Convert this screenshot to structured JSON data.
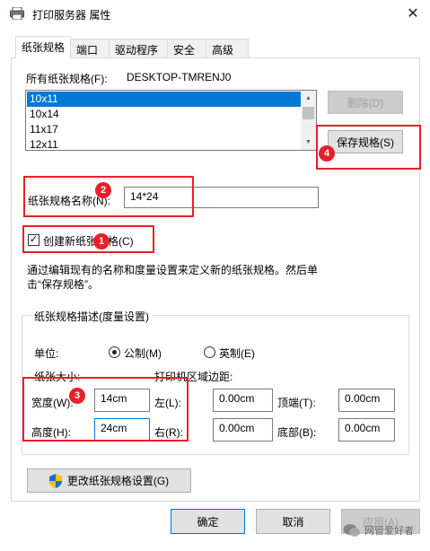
{
  "window": {
    "title": "打印服务器 属性",
    "close_symbol": "✕"
  },
  "tabs": [
    {
      "label": "纸张规格",
      "active": true
    },
    {
      "label": "端口",
      "active": false
    },
    {
      "label": "驱动程序",
      "active": false
    },
    {
      "label": "安全",
      "active": false
    },
    {
      "label": "高级",
      "active": false
    }
  ],
  "forms": {
    "all_forms_label": "所有纸张规格(F):",
    "server_name": "DESKTOP-TMRENJ0",
    "items": [
      "10x11",
      "10x14",
      "11x17",
      "12x11"
    ],
    "selected_index": 0,
    "delete_button": "删除(D)",
    "save_button": "保存规格(S)",
    "form_name_label": "纸张规格名称(N):",
    "form_name_value": "14*24",
    "create_checkbox_label": "创建新纸张规格(C)",
    "create_checked": true,
    "description_line1": "通过编辑现有的名称和度量设置来定义新的纸张规格。然后单",
    "description_line2": "击“保存规格”。"
  },
  "measurements": {
    "group_title": "纸张规格描述(度量设置)",
    "units_label": "单位:",
    "metric_label": "公制(M)",
    "english_label": "英制(E)",
    "metric_selected": true,
    "paper_size_label": "纸张大小:",
    "printer_area_label": "打印机区域边距:",
    "width_label": "宽度(W):",
    "width_value": "14cm",
    "height_label": "高度(H):",
    "height_value": "24cm",
    "left_label": "左(L):",
    "left_value": "0.00cm",
    "right_label": "右(R):",
    "right_value": "0.00cm",
    "top_label": "顶端(T):",
    "top_value": "0.00cm",
    "bottom_label": "底部(B):",
    "bottom_value": "0.00cm"
  },
  "change_settings_button": "更改纸张规格设置(G)",
  "dialog_buttons": {
    "ok": "确定",
    "cancel": "取消",
    "apply": "应用(A)"
  },
  "annotations": {
    "badge1": "1",
    "badge2": "2",
    "badge3": "3",
    "badge4": "4",
    "color": "#e8202a"
  },
  "watermark": "网管爱好者"
}
